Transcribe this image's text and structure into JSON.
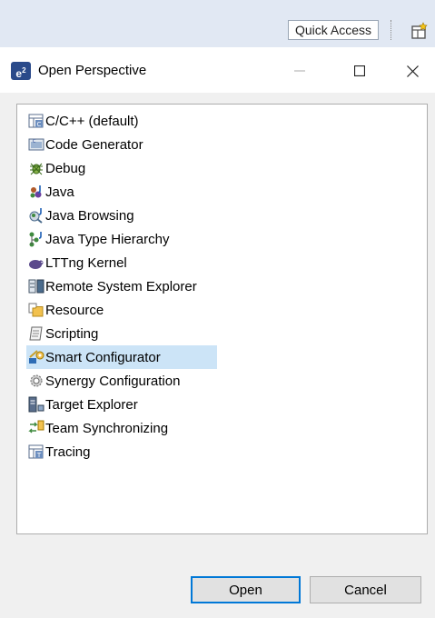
{
  "toolbar": {
    "quick_access": "Quick Access",
    "open_perspective_icon": "open-perspective-icon"
  },
  "dialog": {
    "title": "Open Perspective",
    "app_icon_text": "e",
    "app_icon_sup": "2",
    "minimize_glyph": "—",
    "maximize_glyph": "☐",
    "close_glyph": "✕"
  },
  "perspectives": [
    {
      "label": "C/C++ (default)",
      "icon": "cpp-perspective-icon"
    },
    {
      "label": "Code Generator",
      "icon": "code-generator-icon"
    },
    {
      "label": "Debug",
      "icon": "debug-icon"
    },
    {
      "label": "Java",
      "icon": "java-icon"
    },
    {
      "label": "Java Browsing",
      "icon": "java-browsing-icon"
    },
    {
      "label": "Java Type Hierarchy",
      "icon": "java-type-hierarchy-icon"
    },
    {
      "label": "LTTng Kernel",
      "icon": "lttng-kernel-icon"
    },
    {
      "label": "Remote System Explorer",
      "icon": "remote-system-explorer-icon"
    },
    {
      "label": "Resource",
      "icon": "resource-icon"
    },
    {
      "label": "Scripting",
      "icon": "scripting-icon"
    },
    {
      "label": "Smart Configurator",
      "icon": "smart-configurator-icon",
      "selected": true
    },
    {
      "label": "Synergy Configuration",
      "icon": "synergy-configuration-icon"
    },
    {
      "label": "Target Explorer",
      "icon": "target-explorer-icon"
    },
    {
      "label": "Team Synchronizing",
      "icon": "team-synchronizing-icon"
    },
    {
      "label": "Tracing",
      "icon": "tracing-icon"
    }
  ],
  "buttons": {
    "open": "Open",
    "cancel": "Cancel"
  },
  "colors": {
    "selection": "#cce4f7",
    "default_button_border": "#0078d7",
    "toolbar_bg": "#e1e8f3"
  }
}
